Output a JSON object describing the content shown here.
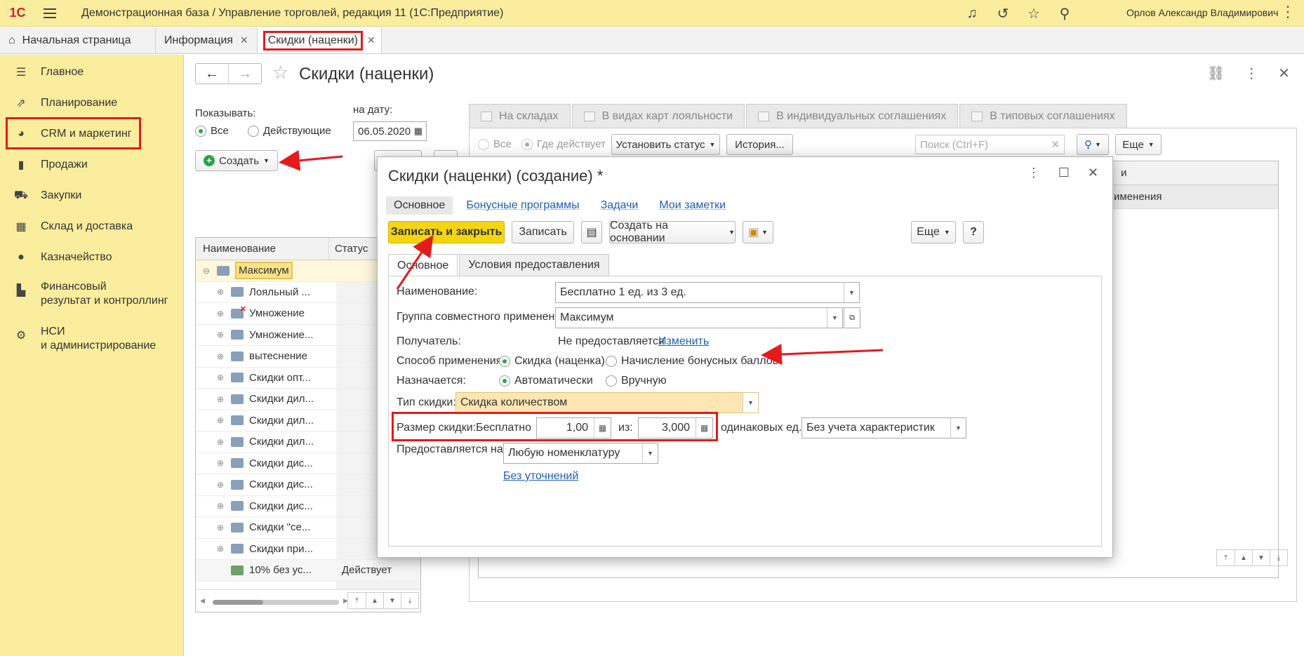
{
  "app": {
    "logo": "1С",
    "title": "Демонстрационная база / Управление торговлей, редакция 11   (1С:Предприятие)",
    "user": "Орлов Александр Владимирович"
  },
  "tabs": [
    {
      "label": "Начальная страница",
      "icon": "home-icon"
    },
    {
      "label": "Информация",
      "icon": "close-icon"
    },
    {
      "label": "Скидки (наценки)",
      "icon": "close-icon"
    }
  ],
  "sidebar": {
    "items": [
      {
        "label": "Главное",
        "icon": "menu-lines-icon"
      },
      {
        "label": "Планирование",
        "icon": "chart-growth-icon"
      },
      {
        "label": "CRM и маркетинг",
        "icon": "pie-chart-icon"
      },
      {
        "label": "Продажи",
        "icon": "shopping-bag-icon"
      },
      {
        "label": "Закупки",
        "icon": "cart-icon"
      },
      {
        "label": "Склад и доставка",
        "icon": "grid-icon"
      },
      {
        "label": "Казначейство",
        "icon": "ruble-coin-icon"
      },
      {
        "label1": "Финансовый",
        "label2": "результат и контроллинг",
        "icon": "bar-chart-icon"
      },
      {
        "label1": "НСИ",
        "label2": "и администрирование",
        "icon": "gear-icon"
      }
    ]
  },
  "page": {
    "title": "Скидки (наценки)",
    "show_label": "Показывать:",
    "show_all": "Все",
    "show_active": "Действующие",
    "date_label": "на дату:",
    "date_value": "06.05.2020",
    "create_btn": "Создать"
  },
  "list": {
    "col_name": "Наименование",
    "col_status": "Статус",
    "rows": [
      {
        "name": "Максимум",
        "status": ""
      },
      {
        "name": "Лояльный ...",
        "status": ""
      },
      {
        "name": "Умножение",
        "status": ""
      },
      {
        "name": "Умножение...",
        "status": ""
      },
      {
        "name": "вытеснение",
        "status": ""
      },
      {
        "name": "Скидки опт...",
        "status": ""
      },
      {
        "name": "Скидки дил...",
        "status": ""
      },
      {
        "name": "Скидки дил...",
        "status": ""
      },
      {
        "name": "Скидки дил...",
        "status": ""
      },
      {
        "name": "Скидки дис...",
        "status": ""
      },
      {
        "name": "Скидки дис...",
        "status": ""
      },
      {
        "name": "Скидки дис...",
        "status": ""
      },
      {
        "name": "Скидки \"се...",
        "status": ""
      },
      {
        "name": "Скидки при...",
        "status": ""
      },
      {
        "name": "10% без ус...",
        "status": "Действует"
      }
    ]
  },
  "right": {
    "tabs": [
      "На складах",
      "В видах карт лояльности",
      "В индивидуальных соглашениях",
      "В типовых соглашениях"
    ],
    "radio_all": "Все",
    "radio_where": "Где действует",
    "set_status": "Установить статус",
    "history": "История...",
    "search_placeholder": "Поиск (Ctrl+F)",
    "more": "Еще",
    "col_partial1": "и",
    "col_partial2": "именения"
  },
  "dialog": {
    "title": "Скидки (наценки) (создание) *",
    "tabs": [
      "Основное",
      "Бонусные программы",
      "Задачи",
      "Мои заметки"
    ],
    "save_close": "Записать и закрыть",
    "save": "Записать",
    "create_based": "Создать на основании",
    "more": "Еще",
    "help": "?",
    "inner_tabs": [
      "Основное",
      "Условия предоставления"
    ],
    "fields": {
      "name_label": "Наименование:",
      "name_value": "Бесплатно 1 ед. из 3 ед.",
      "group_label": "Группа совместного применения:",
      "group_value": "Максимум",
      "recipient_label": "Получатель:",
      "recipient_value": "Не предоставляется",
      "recipient_link": "Изменить",
      "method_label": "Способ применения:",
      "method_opt1": "Скидка (наценка)",
      "method_opt2": "Начисление бонусных баллов",
      "assigned_label": "Назначается:",
      "assigned_opt1": "Автоматически",
      "assigned_opt2": "Вручную",
      "type_label": "Тип скидки:",
      "type_value": "Скидка количеством",
      "size_label": "Размер скидки:",
      "size_free": "Бесплатно",
      "size_value": "1,00",
      "size_of": "из:",
      "size_total": "3,000",
      "size_units": "одинаковых ед.",
      "chars_value": "Без учета характеристик",
      "provided_label": "Предоставляется на:",
      "provided_value": "Любую номенклатуру",
      "provided_link": "Без уточнений"
    }
  },
  "colors": {
    "sidebar_bg": "#fbed9e",
    "accent_yellow": "#f5d512",
    "highlight_red": "#e51a1a",
    "link_blue": "#1f5fb0",
    "radio_green": "#2aa34a"
  }
}
